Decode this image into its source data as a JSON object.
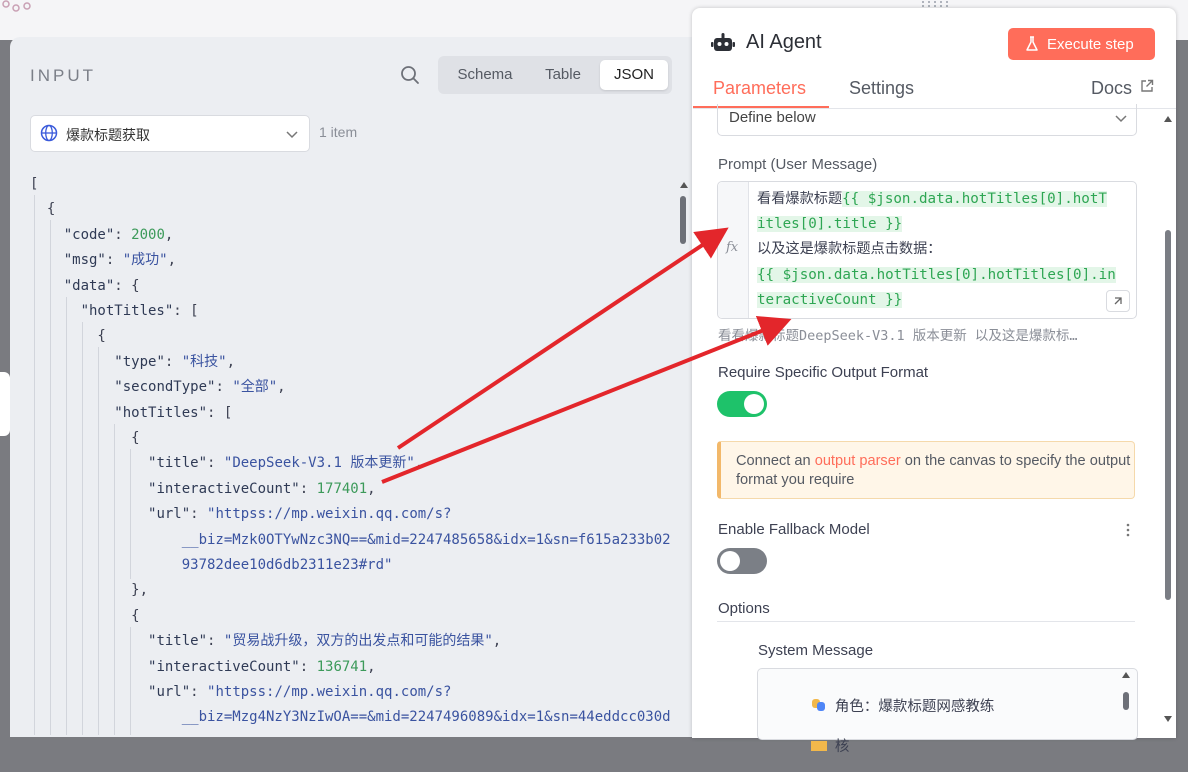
{
  "input_panel": {
    "title": "INPUT",
    "view_tabs": [
      "Schema",
      "Table",
      "JSON"
    ],
    "active_view": "JSON",
    "node_selector": "爆款标题获取",
    "item_count": "1 item",
    "json_lines": [
      "[",
      "  {",
      "    \"code\": 2000,",
      "    \"msg\": \"成功\",",
      "    \"data\": {",
      "      \"hotTitles\": [",
      "        {",
      "          \"type\": \"科技\",",
      "          \"secondType\": \"全部\",",
      "          \"hotTitles\": [",
      "            {",
      "              \"title\": \"DeepSeek-V3.1 版本更新\",",
      "              \"interactiveCount\": 177401,",
      "              \"url\": \"httpss://mp.weixin.qq.com/s?",
      "                  __biz=Mzk0OTYwNzc3NQ==&mid=2247485658&idx=1&sn=f615a233b02",
      "                  93782dee10d6db2311e23#rd\"",
      "            },",
      "            {",
      "              \"title\": \"贸易战升级，双方的出发点和可能的结果\",",
      "              \"interactiveCount\": 136741,",
      "              \"url\": \"httpss://mp.weixin.qq.com/s?",
      "                  __biz=Mzg4NzY3NzIwOA==&mid=2247496089&idx=1&sn=44eddcc030d"
    ]
  },
  "agent_panel": {
    "title": "AI Agent",
    "execute_label": "Execute step",
    "tabs": {
      "parameters": "Parameters",
      "settings": "Settings",
      "docs": "Docs"
    },
    "source_select": "Define below",
    "prompt_label": "Prompt (User Message)",
    "fx_label": "fx",
    "prompt_lines": {
      "l1_text": "看看爆款标题",
      "l1_expr": "{{ $json.data.hotTitles[0].hotT",
      "l2_expr": "itles[0].title }}",
      "l3_text": "以及这是爆款标题点击数据：",
      "l4_expr": "{{ $json.data.hotTitles[0].hotTitles[0].in",
      "l5_expr": "teractiveCount }}"
    },
    "prompt_preview": "看看爆款标题DeepSeek-V3.1 版本更新 以及这是爆款标…",
    "require_format_label": "Require Specific Output Format",
    "require_format_on": true,
    "notice": {
      "before": "Connect an ",
      "link": "output parser",
      "after": " on the canvas to specify the output format you require"
    },
    "fallback_label": "Enable Fallback Model",
    "fallback_on": false,
    "options_label": "Options",
    "system_message_label": "System Message",
    "system_message_line": "角色：爆款标题网感教练",
    "system_message_line2": "核"
  },
  "colors": {
    "accent": "#ff6d5a",
    "toggle_on": "#1ec26a",
    "arrow": "#e3262b",
    "expr_green": "#2ea653"
  }
}
